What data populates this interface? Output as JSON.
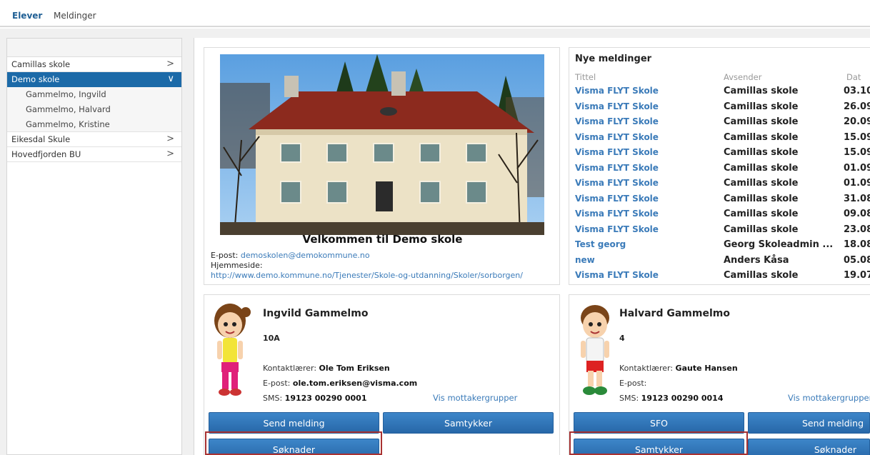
{
  "nav": {
    "tab_elever": "Elever",
    "tab_meldinger": "Meldinger"
  },
  "sidebar": {
    "schools": [
      {
        "label": "Camillas skole",
        "chevron": ">"
      },
      {
        "label": "Demo skole",
        "chevron": "∨"
      },
      {
        "label": "Eikesdal Skule",
        "chevron": ">"
      },
      {
        "label": "Hovedfjorden BU",
        "chevron": ">"
      }
    ],
    "students": [
      "Gammelmo, Ingvild",
      "Gammelmo, Halvard",
      "Gammelmo, Kristine"
    ]
  },
  "school": {
    "welcome": "Velkommen til Demo skole",
    "email_label": "E-post:",
    "email": "demoskolen@demokommune.no",
    "homepage_label": "Hjemmeside:",
    "homepage": "http://www.demo.kommune.no/Tjenester/Skole-og-utdanning/Skoler/sorborgen/"
  },
  "messages": {
    "title": "Nye meldinger",
    "col_title": "Tittel",
    "col_sender": "Avsender",
    "col_date": "Dat",
    "rows": [
      {
        "title": "Visma FLYT Skole",
        "sender": "Camillas skole",
        "date": "03.10"
      },
      {
        "title": "Visma FLYT Skole",
        "sender": "Camillas skole",
        "date": "26.09"
      },
      {
        "title": "Visma FLYT Skole",
        "sender": "Camillas skole",
        "date": "20.09"
      },
      {
        "title": "Visma FLYT Skole",
        "sender": "Camillas skole",
        "date": "15.09"
      },
      {
        "title": "Visma FLYT Skole",
        "sender": "Camillas skole",
        "date": "15.09"
      },
      {
        "title": "Visma FLYT Skole",
        "sender": "Camillas skole",
        "date": "01.09"
      },
      {
        "title": "Visma FLYT Skole",
        "sender": "Camillas skole",
        "date": "01.09"
      },
      {
        "title": "Visma FLYT Skole",
        "sender": "Camillas skole",
        "date": "31.08"
      },
      {
        "title": "Visma FLYT Skole",
        "sender": "Camillas skole",
        "date": "09.08"
      },
      {
        "title": "Visma FLYT Skole",
        "sender": "Camillas skole",
        "date": "23.08"
      },
      {
        "title": "Test georg",
        "sender": "Georg Skoleadmin ...",
        "date": "18.08"
      },
      {
        "title": "new",
        "sender": "Anders Kåsa",
        "date": "05.08"
      },
      {
        "title": "Visma FLYT Skole",
        "sender": "Camillas skole",
        "date": "19.07"
      }
    ]
  },
  "student1": {
    "name": "Ingvild Gammelmo",
    "class": "10A",
    "teacher_label": "Kontaktlærer:",
    "teacher": "Ole Tom Eriksen",
    "email_label": "E-post:",
    "email": "ole.tom.eriksen@visma.com",
    "sms_label": "SMS:",
    "sms": "19123 00290 0001",
    "groups_link": "Vis mottakergrupper",
    "btn_send": "Send melding",
    "btn_consent": "Samtykker",
    "btn_apps": "Søknader"
  },
  "student2": {
    "name": "Halvard Gammelmo",
    "class": "4",
    "teacher_label": "Kontaktlærer:",
    "teacher": "Gaute Hansen",
    "email_label": "E-post:",
    "sms_label": "SMS:",
    "sms": "19123 00290 0014",
    "groups_link": "Vis mottakergrupper",
    "btn_sfo": "SFO",
    "btn_send": "Send melding",
    "btn_consent": "Samtykker",
    "btn_apps": "Søknader"
  }
}
